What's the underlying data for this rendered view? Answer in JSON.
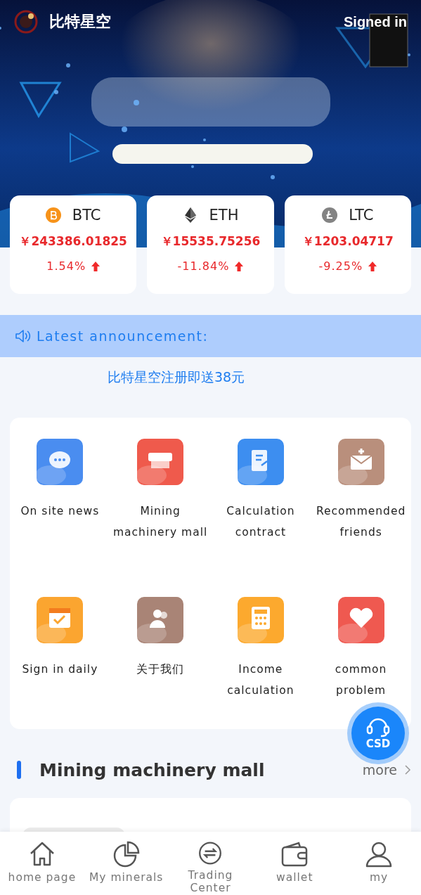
{
  "header": {
    "app_name": "比特星空",
    "signin": "Signed in"
  },
  "coins": [
    {
      "symbol": "BTC",
      "kind": "btc",
      "price": "￥243386.01825",
      "change": "1.54%",
      "rising": true
    },
    {
      "symbol": "ETH",
      "kind": "eth",
      "price": "￥15535.75256",
      "change": "-11.84%",
      "rising": true
    },
    {
      "symbol": "LTC",
      "kind": "ltc",
      "price": "￥1203.04717",
      "change": "-9.25%",
      "rising": true
    }
  ],
  "announcement": {
    "title": "Latest announcement:",
    "text": "比特星空注册即送38元"
  },
  "menu": [
    {
      "label": "On site news",
      "kind": "chat",
      "color": "#4a8df0"
    },
    {
      "label": "Mining machinery mall",
      "kind": "mall",
      "color": "#ef5a4c"
    },
    {
      "label": "Calculation contract",
      "kind": "contract",
      "color": "#3d8ef0"
    },
    {
      "label": "Recommended friends",
      "kind": "mail",
      "color": "#b98f7c"
    },
    {
      "label": "Sign in daily",
      "kind": "calendar",
      "color": "#fba530"
    },
    {
      "label": "关于我们",
      "kind": "people",
      "color": "#a98476"
    },
    {
      "label": "Income calculation",
      "kind": "calculator",
      "color": "#fca92e"
    },
    {
      "label": "common problem",
      "kind": "heart",
      "color": "#ef5950"
    }
  ],
  "section": {
    "title": "Mining machinery mall",
    "more": "more"
  },
  "support": {
    "label": "CSD"
  },
  "nav": [
    {
      "label": "home page",
      "kind": "home"
    },
    {
      "label": "My minerals",
      "kind": "pie"
    },
    {
      "label": "Trading Center",
      "kind": "exchange"
    },
    {
      "label": "wallet",
      "kind": "wallet"
    },
    {
      "label": "my",
      "kind": "user"
    }
  ]
}
